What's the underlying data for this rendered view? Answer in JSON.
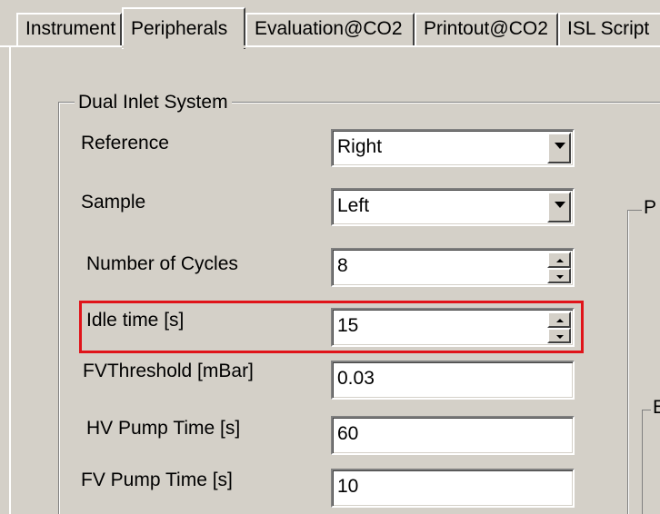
{
  "tabs": [
    {
      "label": "Instrument"
    },
    {
      "label": "Peripherals",
      "active": true
    },
    {
      "label": "Evaluation@CO2"
    },
    {
      "label": "Printout@CO2"
    },
    {
      "label": "ISL Script"
    }
  ],
  "group": {
    "title": "Dual Inlet System"
  },
  "right_group_a": {
    "title": "P"
  },
  "right_group_b": {
    "title": "E"
  },
  "fields": {
    "reference": {
      "label": "Reference",
      "value": "Right"
    },
    "sample": {
      "label": "Sample",
      "value": "Left"
    },
    "cycles": {
      "label": "Number of Cycles",
      "value": "8"
    },
    "idle": {
      "label": "Idle time [s]",
      "value": "15"
    },
    "fvthreshold": {
      "label": "FVThreshold [mBar]",
      "value": "0.03"
    },
    "hvpump": {
      "label": "HV Pump Time [s]",
      "value": "60"
    },
    "fvpump": {
      "label": "FV Pump Time [s]",
      "value": "10"
    }
  },
  "colors": {
    "highlight": "#e0141a",
    "face": "#d4d0c8"
  }
}
